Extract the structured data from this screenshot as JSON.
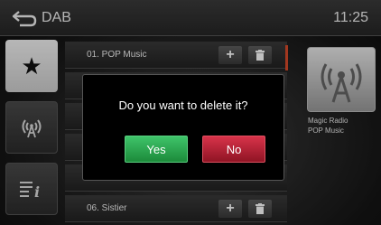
{
  "header": {
    "title": "DAB",
    "time": "11:25",
    "back_icon": "back-arrow-icon"
  },
  "sidebar": {
    "items": [
      {
        "name": "favorites",
        "icon": "star-icon",
        "glyph": "★"
      },
      {
        "name": "stations",
        "icon": "radio-antenna-icon",
        "glyph": "((ᴀ))"
      },
      {
        "name": "info",
        "icon": "list-info-icon",
        "glyph": "≣i"
      }
    ]
  },
  "list": {
    "items": [
      {
        "label": "01.  POP Music"
      },
      {
        "label": ""
      },
      {
        "label": ""
      },
      {
        "label": ""
      },
      {
        "label": ""
      },
      {
        "label": "06.  Sistier"
      }
    ],
    "add_glyph": "+",
    "delete_icon": "trash-icon"
  },
  "station": {
    "name_line1": "Magic Radio",
    "name_line2": "POP Music",
    "icon": "broadcast-antenna-icon"
  },
  "dialog": {
    "message": "Do you want to delete it?",
    "yes_label": "Yes",
    "no_label": "No"
  },
  "colors": {
    "yes": "#2bab52",
    "no": "#c42538",
    "accent": "#d94a2a"
  }
}
